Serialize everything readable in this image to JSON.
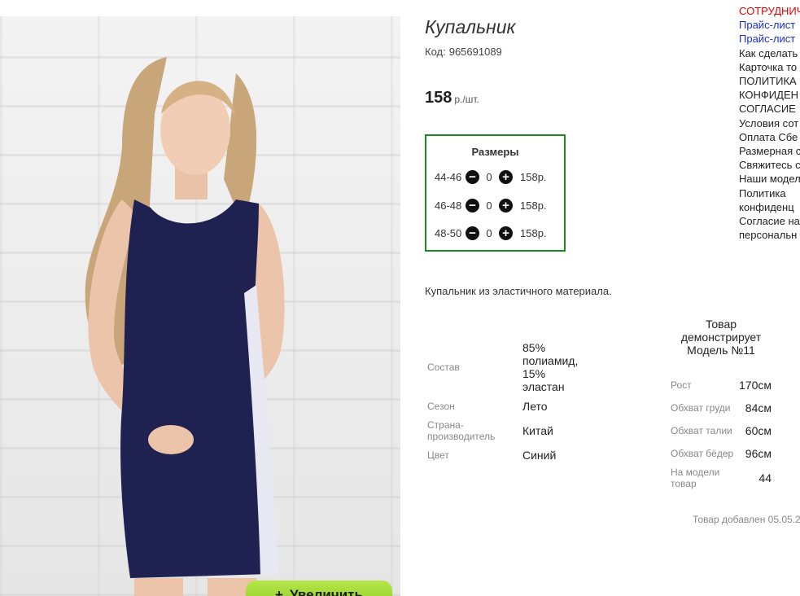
{
  "product": {
    "title": "Купальник",
    "code_label": "Код:",
    "code": "965691089",
    "price": "158",
    "price_unit": "р./шт.",
    "zoom_button": "Увеличить",
    "description": "Купальник из эластичного материала."
  },
  "sizes": {
    "title": "Размеры",
    "rows": [
      {
        "label": "44-46",
        "qty": "0",
        "price": "158р."
      },
      {
        "label": "46-48",
        "qty": "0",
        "price": "158р."
      },
      {
        "label": "48-50",
        "qty": "0",
        "price": "158р."
      }
    ]
  },
  "attributes": [
    {
      "label": "Состав",
      "value": "85% полиамид, 15% эластан"
    },
    {
      "label": "Сезон",
      "value": "Лето"
    },
    {
      "label": "Страна-производитель",
      "value": "Китай"
    },
    {
      "label": "Цвет",
      "value": "Синий"
    }
  ],
  "model": {
    "heading": "Товар демонстрирует Модель №11",
    "rows": [
      {
        "label": "Рост",
        "value": "170см"
      },
      {
        "label": "Обхват груди",
        "value": "84см"
      },
      {
        "label": "Обхват талии",
        "value": "60см"
      },
      {
        "label": "Обхват бёдер",
        "value": "96см"
      },
      {
        "label": "На модели товар",
        "value": "44"
      }
    ],
    "added": "Товар добавлен 05.05.2"
  },
  "right_menu": [
    {
      "label": "СОТРУДНИЧ",
      "color": "red"
    },
    {
      "label": "Прайс-лист",
      "color": "blue"
    },
    {
      "label": "Прайс-лист",
      "color": "blue"
    },
    {
      "label": "Как сделать",
      "color": "dark"
    },
    {
      "label": "Карточка то",
      "color": "dark"
    },
    {
      "label": "ПОЛИТИКА",
      "color": "dark"
    },
    {
      "label": "КОНФИДЕН",
      "color": "dark"
    },
    {
      "label": "СОГЛАСИЕ",
      "color": "dark"
    },
    {
      "label": "Условия сот",
      "color": "dark"
    },
    {
      "label": "Оплата Сбе",
      "color": "dark"
    },
    {
      "label": "Размерная с",
      "color": "dark"
    },
    {
      "label": "Свяжитесь с",
      "color": "dark"
    },
    {
      "label": "Наши модел",
      "color": "dark"
    },
    {
      "label": "Политика",
      "color": "dark"
    },
    {
      "label": "конфиденц",
      "color": "dark"
    },
    {
      "label": "Согласие на",
      "color": "dark"
    },
    {
      "label": "персональн",
      "color": "dark"
    }
  ],
  "colors": {
    "sizes_border": "#1a8a1a",
    "swimsuit": "#1f2250",
    "zoom_button": "#8fd01f",
    "menu_red": "#e60000",
    "menu_blue": "#1a2fcc"
  }
}
